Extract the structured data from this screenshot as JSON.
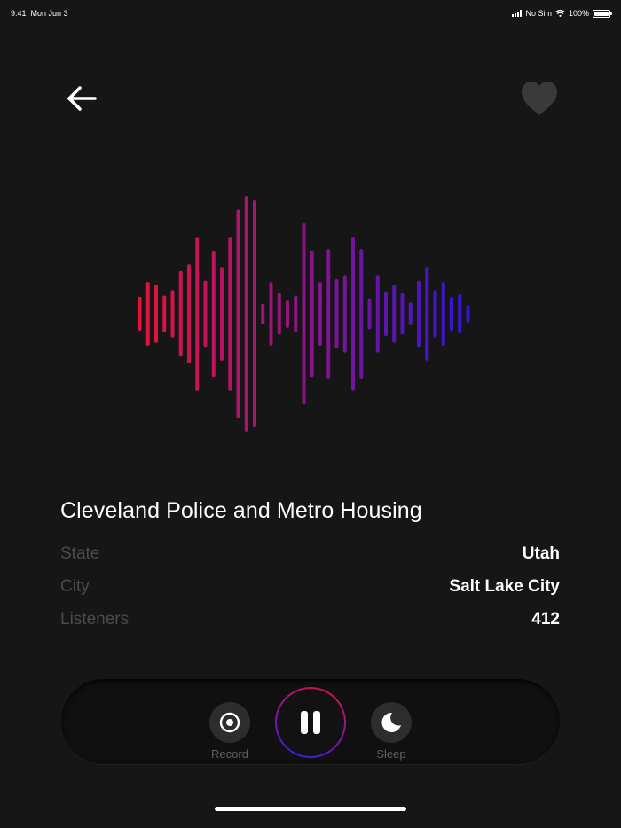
{
  "status_bar": {
    "time": "9:41",
    "date": "Mon Jun 3",
    "carrier": "No Sim",
    "battery": "100%"
  },
  "header": {
    "back_icon": "arrow-left-icon",
    "favorite_icon": "heart-icon"
  },
  "waveform": {
    "colors": {
      "start": "#e8123a",
      "end": "#2a16dc"
    },
    "bar_levels": [
      0.11,
      0.22,
      0.2,
      0.12,
      0.16,
      0.3,
      0.35,
      0.55,
      0.23,
      0.45,
      0.33,
      0.55,
      0.75,
      0.85,
      0.82,
      0.06,
      0.22,
      0.14,
      0.09,
      0.12,
      0.65,
      0.45,
      0.22,
      0.46,
      0.24,
      0.27,
      0.55,
      0.46,
      0.1,
      0.27,
      0.15,
      0.2,
      0.14,
      0.07,
      0.23,
      0.33,
      0.16,
      0.22,
      0.11,
      0.13,
      0.05
    ]
  },
  "station": {
    "title": "Cleveland Police and Metro Housing",
    "details": [
      {
        "label": "State",
        "value": "Utah"
      },
      {
        "label": "City",
        "value": "Salt Lake City"
      },
      {
        "label": "Listeners",
        "value": "412"
      }
    ]
  },
  "controls": {
    "record_label": "Record",
    "sleep_label": "Sleep",
    "record_icon": "record-icon",
    "pause_icon": "pause-icon",
    "sleep_icon": "moon-icon",
    "ring_colors": [
      "#e0103a",
      "#7b1aa8",
      "#2a1fe0"
    ]
  }
}
